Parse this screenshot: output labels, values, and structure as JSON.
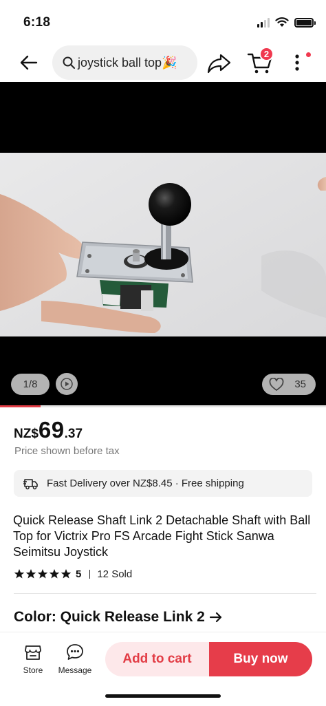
{
  "status_bar": {
    "time": "6:18"
  },
  "header": {
    "search_query": "joystick ball top🎉",
    "cart_count": "2"
  },
  "media": {
    "page_indicator": "1/8",
    "like_count": "35",
    "progress_fraction": 0.125
  },
  "price": {
    "currency": "NZ$",
    "integer": "69",
    "decimal": ".37",
    "note": "Price shown before tax"
  },
  "delivery": {
    "text": "Fast Delivery over NZ$8.45 · Free shipping"
  },
  "product": {
    "title": "Quick Release Shaft Link 2 Detachable Shaft with Ball Top for Victrix Pro FS Arcade Fight Stick Sanwa Seimitsu Joystick",
    "rating": "5",
    "stars": 5,
    "sold": "12 Sold"
  },
  "variant": {
    "label": "Color: Quick Release Link 2"
  },
  "bottom_bar": {
    "store_label": "Store",
    "message_label": "Message",
    "add_to_cart_label": "Add to cart",
    "buy_now_label": "Buy now"
  },
  "colors": {
    "accent": "#e63d4a",
    "accent_light": "#fde8ea",
    "badge": "#f0394f"
  }
}
